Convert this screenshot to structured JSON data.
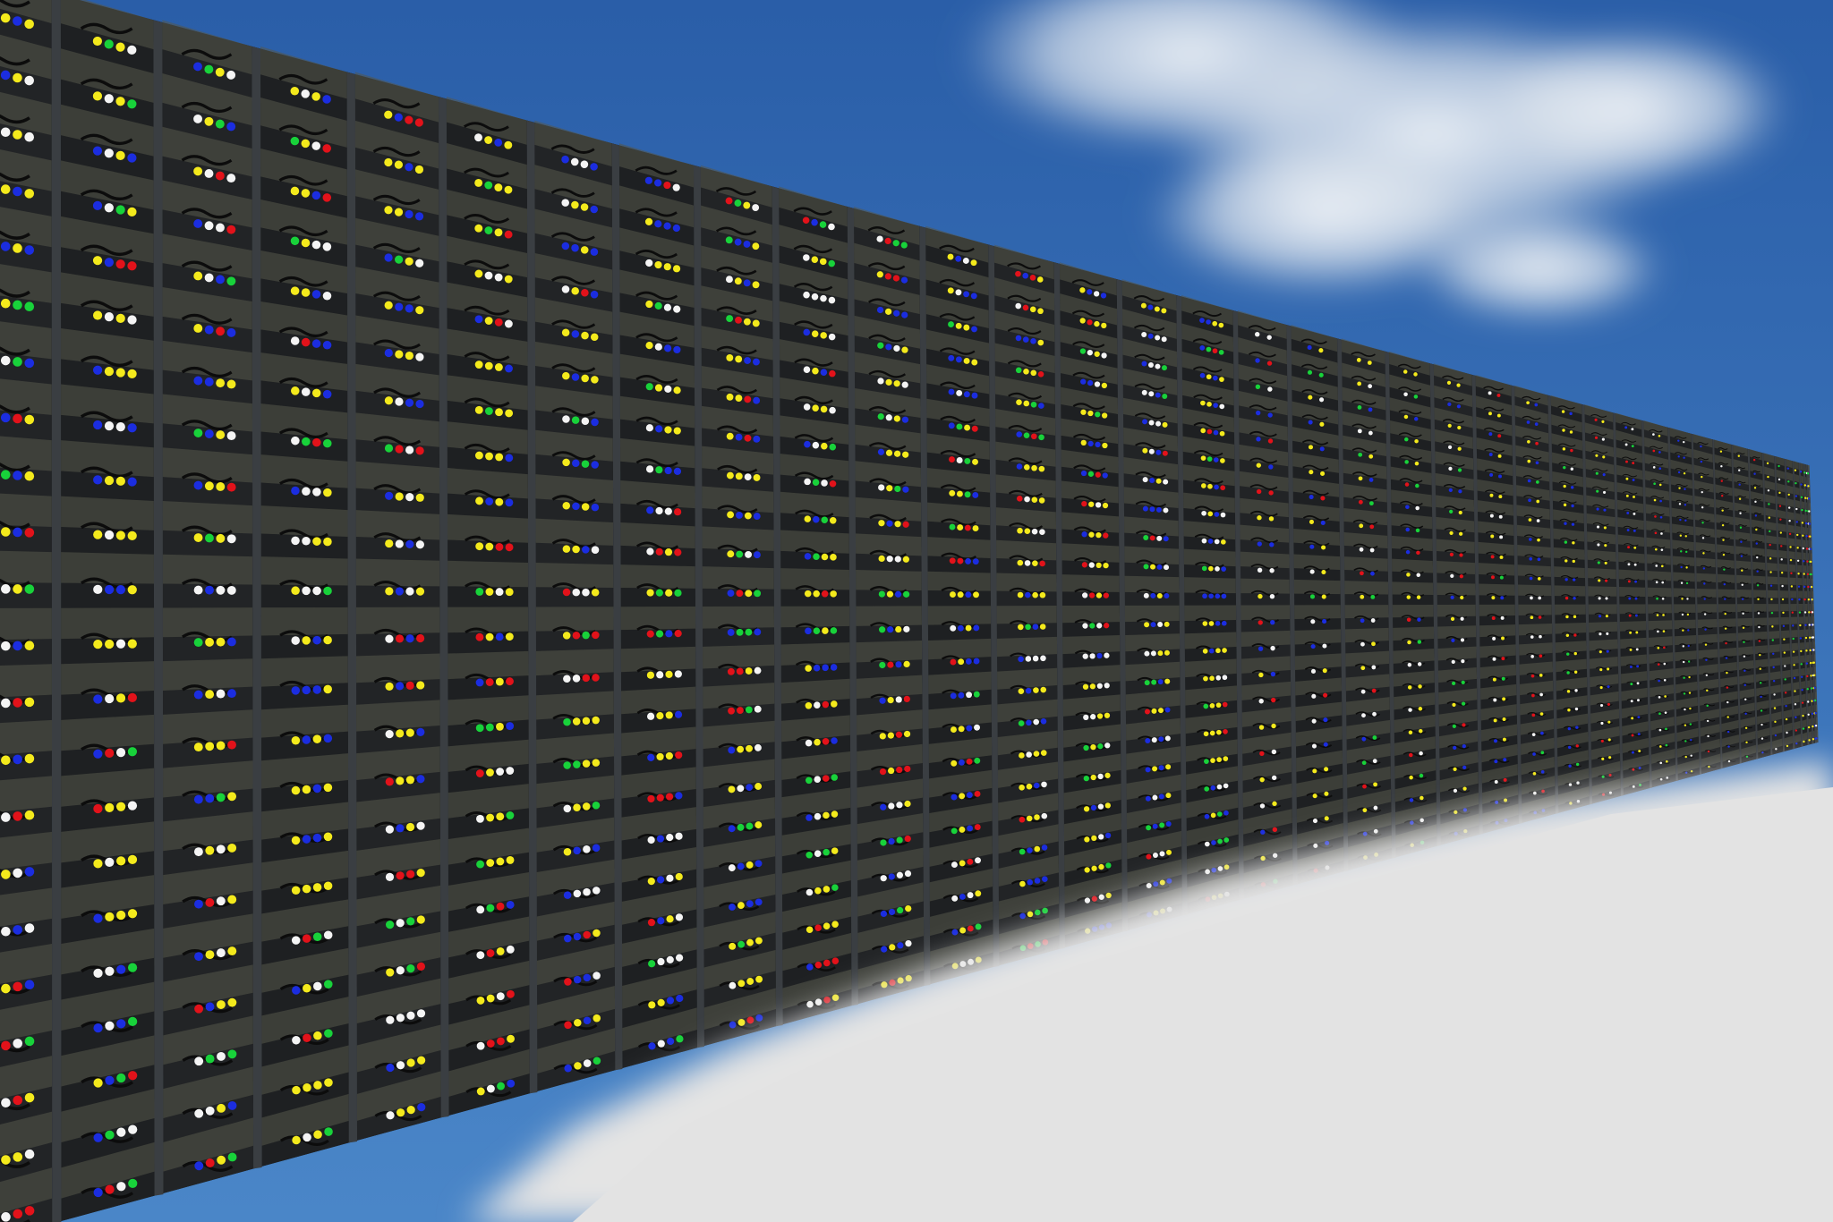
{
  "scene": {
    "subject": "server-rack-wall",
    "rack_count_estimate": 40,
    "colors": {
      "sky_top": "#2a5ea8",
      "sky_bottom": "#4a86c8",
      "cloud": "#e9eef4",
      "rack_body": "#1b1d1f",
      "rack_frame": "#3a3e42",
      "shelf": "#55584a",
      "cable": "#0c0c0c",
      "fog": "#e8e8e8",
      "led_yellow": "#f4ea1c",
      "led_blue": "#1b2de0",
      "led_red": "#e2121a",
      "led_white": "#f4f4f4",
      "led_green": "#18d23a"
    }
  }
}
